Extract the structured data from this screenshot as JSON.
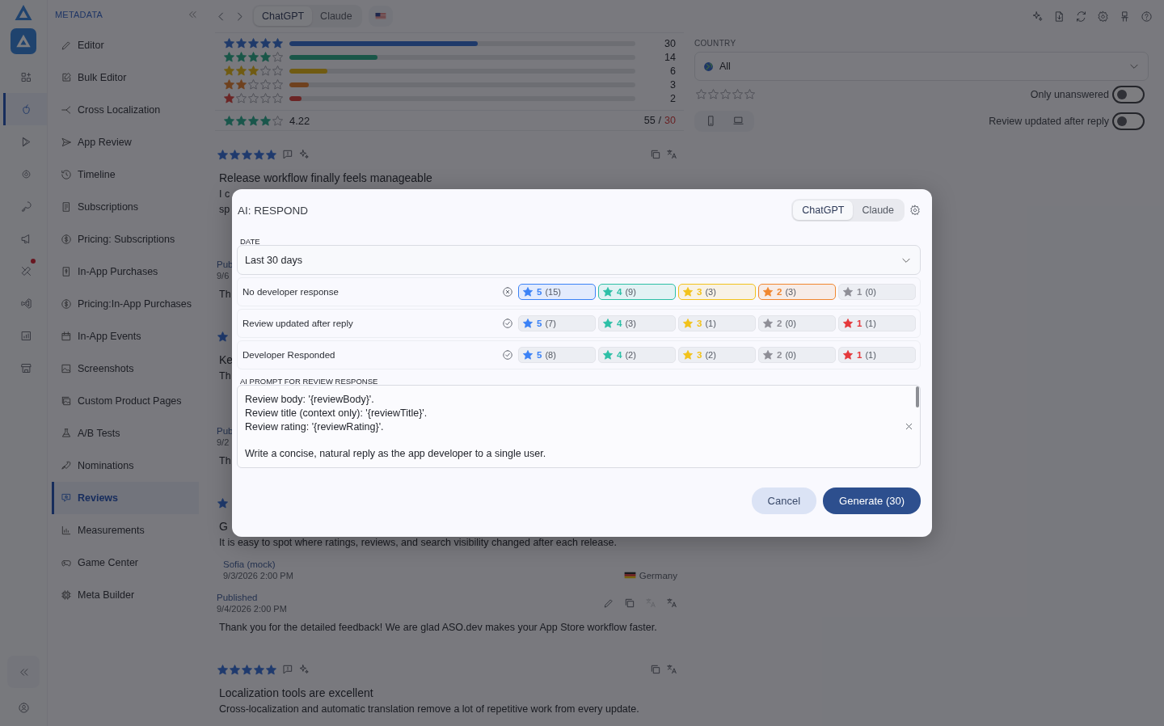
{
  "rail": {
    "items": [
      {
        "selected": false,
        "badge": false
      },
      {
        "selected": true,
        "badge": false
      },
      {
        "selected": false,
        "badge": false
      },
      {
        "selected": false,
        "badge": false
      },
      {
        "selected": false,
        "badge": false
      },
      {
        "selected": false,
        "badge": false
      },
      {
        "selected": false,
        "badge": true
      },
      {
        "selected": false,
        "badge": false
      },
      {
        "selected": false,
        "badge": false
      },
      {
        "selected": false,
        "badge": false
      }
    ]
  },
  "sidebar": {
    "heading": "METADATA",
    "items": [
      {
        "label": "Editor",
        "selected": false
      },
      {
        "label": "Bulk Editor",
        "selected": false
      },
      {
        "label": "Cross Localization",
        "selected": false
      },
      {
        "label": "App Review",
        "selected": false
      },
      {
        "label": "Timeline",
        "selected": false
      },
      {
        "label": "Subscriptions",
        "selected": false
      },
      {
        "label": "Pricing: Subscriptions",
        "selected": false
      },
      {
        "label": "In-App Purchases",
        "selected": false
      },
      {
        "label": "Pricing:In-App Purchases",
        "selected": false
      },
      {
        "label": "In-App Events",
        "selected": false
      },
      {
        "label": "Screenshots",
        "selected": false
      },
      {
        "label": "Custom Product Pages",
        "selected": false
      },
      {
        "label": "A/B Tests",
        "selected": false
      },
      {
        "label": "Nominations",
        "selected": false
      },
      {
        "label": "Reviews",
        "selected": true
      },
      {
        "label": "Measurements",
        "selected": false
      },
      {
        "label": "Game Center",
        "selected": false
      },
      {
        "label": "Meta Builder",
        "selected": false
      }
    ]
  },
  "topbar": {
    "models": [
      {
        "label": "ChatGPT",
        "selected": true
      },
      {
        "label": "Claude",
        "selected": false
      }
    ]
  },
  "summary": {
    "rows": [
      {
        "stars": 5,
        "color": "#1f3a6a",
        "level": 0.545,
        "count": "30"
      },
      {
        "stars": 4,
        "color": "#195648",
        "level": 0.255,
        "count": "14"
      },
      {
        "stars": 3,
        "color": "#705b12",
        "level": 0.109,
        "count": "6"
      },
      {
        "stars": 2,
        "color": "#6f411e",
        "level": 0.055,
        "count": "3"
      },
      {
        "stars": 1,
        "color": "#6b2525",
        "level": 0.036,
        "count": "2"
      }
    ],
    "average": {
      "stars": 4,
      "value": "4.22",
      "total": "55",
      "separator": "/",
      "limit": "30"
    }
  },
  "reviews": [
    {
      "kind": "full",
      "stars": 5,
      "title": "Release workflow finally feels manageable",
      "body": [
        "I c",
        "sp"
      ],
      "published": {
        "label": "Pub",
        "date": "9/6"
      },
      "reply": "Th"
    },
    {
      "kind": "partial",
      "title": "Ke",
      "body": [
        "Th"
      ],
      "published": {
        "label": "Pub",
        "date": "9/2"
      },
      "reply": "Th"
    },
    {
      "kind": "partial",
      "title": "G",
      "body": [
        "It is easy to spot where ratings, reviews, and search visibility changed after each release."
      ],
      "author": {
        "name": "Sofia (mock)",
        "date": "9/3/2026 2:00 PM",
        "country": "Germany"
      },
      "published": {
        "label": "Published",
        "date": "9/4/2026 2:00 PM",
        "actions": true
      },
      "reply": "Thank you for the detailed feedback! We are glad ASO.dev makes your App Store workflow faster."
    },
    {
      "kind": "full",
      "stars": 5,
      "title": "Localization tools are excellent",
      "body": [
        "Cross-localization and automatic translation remove a lot of repetitive work from every update."
      ]
    }
  ],
  "filters": {
    "country_label": "COUNTRY",
    "country": "All",
    "stars": 0,
    "devices": [
      {
        "selected": false
      },
      {
        "selected": false
      }
    ],
    "toggles": [
      {
        "label": "Only unanswered",
        "on": false
      },
      {
        "label": "Review updated after reply",
        "on": false
      }
    ]
  },
  "modal": {
    "title": "AI: RESPOND",
    "models": [
      {
        "label": "ChatGPT",
        "selected": true
      },
      {
        "label": "Claude",
        "selected": false
      }
    ],
    "date_label": "DATE",
    "date": "Last 30 days",
    "groups": [
      {
        "label": "No developer response",
        "checked": false,
        "chips": [
          {
            "value": "5",
            "count": "(15)",
            "color": "#3b82f6",
            "selected": true
          },
          {
            "value": "4",
            "count": "(9)",
            "color": "#2dbfa6",
            "selected": true
          },
          {
            "value": "3",
            "count": "(3)",
            "color": "#f2c21b",
            "selected": true
          },
          {
            "value": "2",
            "count": "(3)",
            "color": "#f0862e",
            "selected": true
          },
          {
            "value": "1",
            "count": "(0)",
            "color": "#8e8e96",
            "selected": false
          }
        ]
      },
      {
        "label": "Review updated after reply",
        "checked": true,
        "chips": [
          {
            "value": "5",
            "count": "(7)",
            "color": "#3b82f6",
            "selected": false
          },
          {
            "value": "4",
            "count": "(3)",
            "color": "#2dbfa6",
            "selected": false
          },
          {
            "value": "3",
            "count": "(1)",
            "color": "#f2c21b",
            "selected": false
          },
          {
            "value": "2",
            "count": "(0)",
            "color": "#8e8e96",
            "selected": false
          },
          {
            "value": "1",
            "count": "(1)",
            "color": "#e5383b",
            "selected": false
          }
        ]
      },
      {
        "label": "Developer Responded",
        "checked": true,
        "chips": [
          {
            "value": "5",
            "count": "(8)",
            "color": "#3b82f6",
            "selected": false
          },
          {
            "value": "4",
            "count": "(2)",
            "color": "#2dbfa6",
            "selected": false
          },
          {
            "value": "3",
            "count": "(2)",
            "color": "#f2c21b",
            "selected": false
          },
          {
            "value": "2",
            "count": "(0)",
            "color": "#8e8e96",
            "selected": false
          },
          {
            "value": "1",
            "count": "(1)",
            "color": "#e5383b",
            "selected": false
          }
        ]
      }
    ],
    "prompt_label": "AI PROMPT FOR REVIEW RESPONSE",
    "prompt": "Review body: '{reviewBody}'.\nReview title (context only): '{reviewTitle}'.\nReview rating: '{reviewRating}'.\n\nWrite a concise, natural reply as the app developer to a single user.",
    "buttons": [
      {
        "label": "Cancel",
        "kind": "secondary"
      },
      {
        "label": "Generate (30)",
        "kind": "primary"
      }
    ]
  }
}
